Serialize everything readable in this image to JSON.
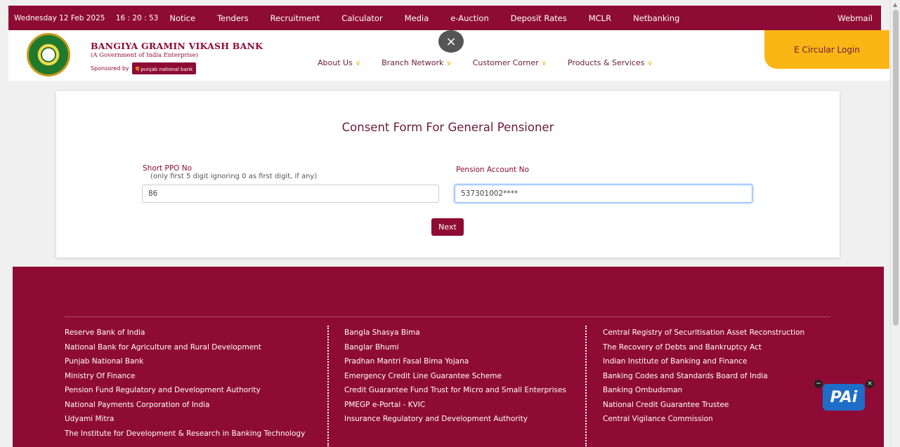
{
  "topbar": {
    "date": "Wednesday 12 Feb 2025",
    "time": "16 : 20 : 53",
    "nav": [
      "Notice",
      "Tenders",
      "Recruitment",
      "Calculator",
      "Media",
      "e-Auction",
      "Deposit Rates",
      "MCLR",
      "Netbanking"
    ],
    "webmail": "Webmail"
  },
  "header": {
    "bank_name": "BANGIYA GRAMIN VIKASH BANK",
    "bank_sub": "(A Government of India Enterprise)",
    "sponsored_by": "Sponsored by",
    "sponsor_name": "punjab national bank",
    "nav": [
      "About Us",
      "Branch Network",
      "Customer Corner",
      "Products & Services"
    ],
    "e_circular": "E Circular Login",
    "close": "×"
  },
  "form": {
    "title": "Consent Form For General Pensioner",
    "ppo_label": "Short PPO No",
    "ppo_hint": "(only first 5 digit ignoring 0 as first digit, if any)",
    "ppo_value": "86",
    "account_label": "Pension Account No",
    "account_value": "537301002****",
    "next_label": "Next"
  },
  "footer": {
    "col1": [
      "Reserve Bank of India",
      "National Bank for Agriculture and Rural Development",
      "Punjab National Bank",
      "Ministry Of Finance",
      "Pension Fund Regulatory and Development Authority",
      "National Payments Corporation of India",
      "Udyami Mitra",
      "The Institute for Development & Research in Banking Technology"
    ],
    "col2": [
      "Bangla Shasya Bima",
      "Banglar Bhumi",
      "Pradhan Mantri Fasal Bima Yojana",
      "Emergency Credit Line Guarantee Scheme",
      "Credit Guarantee Fund Trust for Micro and Small Enterprises",
      "PMEGP e-Portal - KVIC",
      "Insurance Regulatory and Development Authority"
    ],
    "col3": [
      "Central Registry of Securitisation Asset Reconstruction",
      "The Recovery of Debts and Bankruptcy Act",
      "Indian Institute of Banking and Finance",
      "Banking Codes and Standards Board of India",
      "Banking Ombudsman",
      "National Credit Guarantee Trustee",
      "Central Vigilance Commission"
    ]
  },
  "chat": {
    "label": "PAi",
    "minimize": "−",
    "close": "×"
  },
  "colors": {
    "brand": "#8e0b36",
    "accent": "#fbb615"
  }
}
